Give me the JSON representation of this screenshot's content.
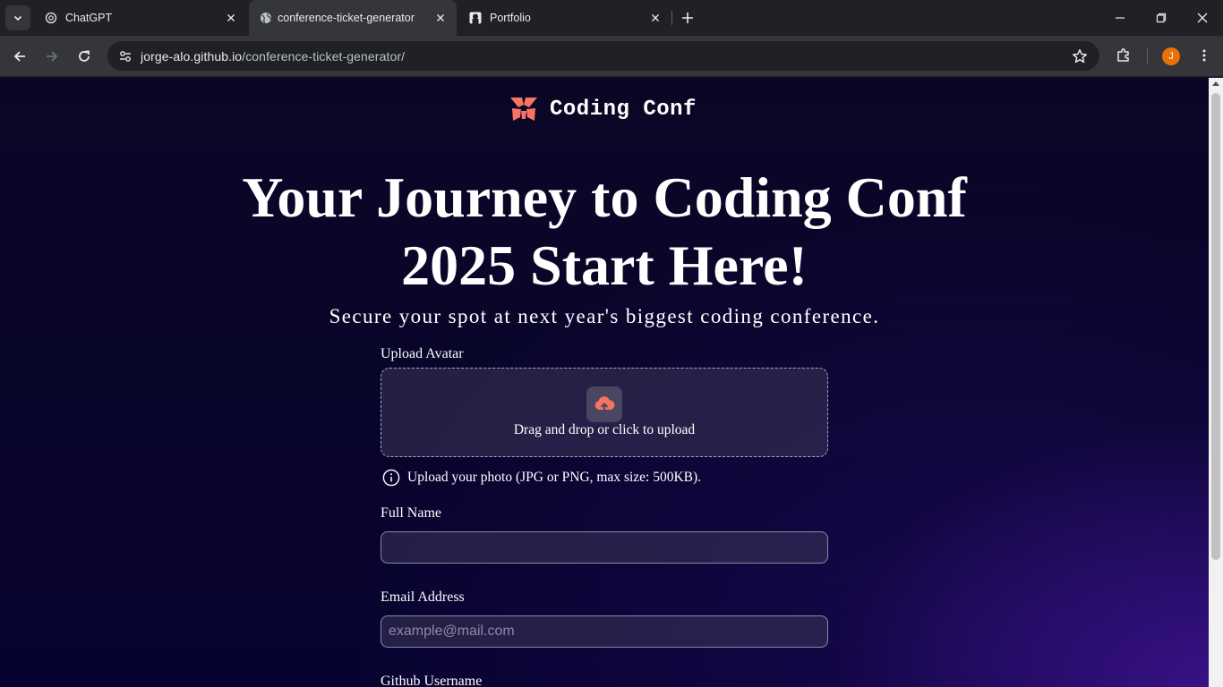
{
  "browser": {
    "tabs": [
      {
        "title": "ChatGPT",
        "icon": "chatgpt-icon",
        "active": false
      },
      {
        "title": "conference-ticket-generator",
        "icon": "globe-icon",
        "active": true
      },
      {
        "title": "Portfolio",
        "icon": "portfolio-icon",
        "active": false
      }
    ],
    "url_host": "jorge-alo.github.io",
    "url_path": "/conference-ticket-generator/",
    "profile_initial": "J"
  },
  "page": {
    "logo_text": "Coding Conf",
    "headline": "Your Journey to Coding Conf 2025 Start Here!",
    "subheadline": "Secure your spot at next year's biggest coding conference.",
    "upload": {
      "label": "Upload Avatar",
      "dropzone_text": "Drag and drop or click to upload",
      "hint": "Upload your photo (JPG or PNG, max size: 500KB)."
    },
    "full_name": {
      "label": "Full Name",
      "value": "",
      "placeholder": ""
    },
    "email": {
      "label": "Email Address",
      "value": "",
      "placeholder": "example@mail.com"
    },
    "github": {
      "label": "Github Username"
    }
  },
  "colors": {
    "accent": "#f57463",
    "background": "#0d0a1e",
    "field_bg": "#2a2745"
  }
}
